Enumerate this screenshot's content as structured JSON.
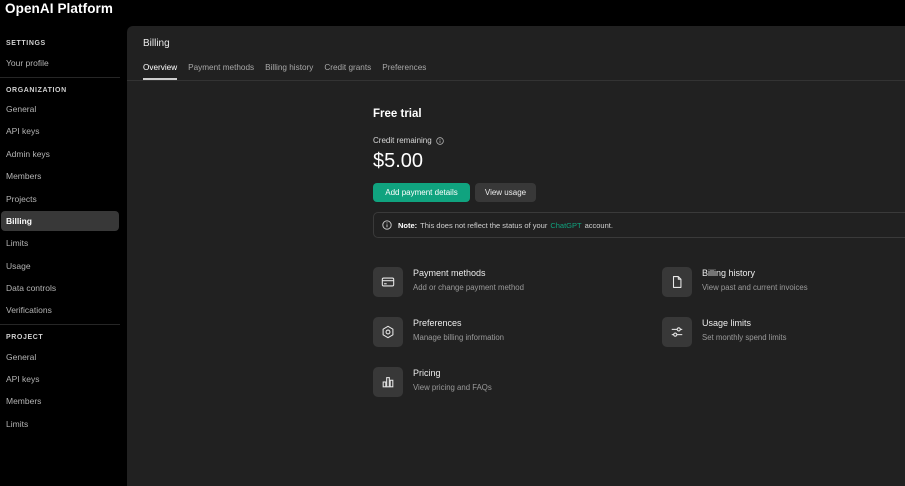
{
  "app": {
    "title": "OpenAI  Platform"
  },
  "sidebar": {
    "settings_heading": "SETTINGS",
    "settings_items": [
      {
        "label": "Your profile"
      }
    ],
    "organization_heading": "ORGANIZATION",
    "organization_items": [
      {
        "label": "General"
      },
      {
        "label": "API keys"
      },
      {
        "label": "Admin keys"
      },
      {
        "label": "Members"
      },
      {
        "label": "Projects"
      },
      {
        "label": "Billing",
        "active": true
      },
      {
        "label": "Limits"
      },
      {
        "label": "Usage"
      },
      {
        "label": "Data controls"
      },
      {
        "label": "Verifications"
      }
    ],
    "project_heading": "PROJECT",
    "project_items": [
      {
        "label": "General"
      },
      {
        "label": "API keys"
      },
      {
        "label": "Members"
      },
      {
        "label": "Limits"
      }
    ]
  },
  "main": {
    "title": "Billing",
    "tabs": [
      {
        "label": "Overview",
        "active": true
      },
      {
        "label": "Payment methods"
      },
      {
        "label": "Billing history"
      },
      {
        "label": "Credit grants"
      },
      {
        "label": "Preferences"
      }
    ],
    "trial": {
      "heading": "Free trial",
      "credit_label": "Credit remaining",
      "credit_value": "$5.00",
      "add_payment_label": "Add payment details",
      "view_usage_label": "View usage"
    },
    "note": {
      "prefix": "Note:",
      "text_before": "This does not reflect the status of your",
      "link": "ChatGPT",
      "text_after": "account."
    },
    "cards": [
      {
        "title": "Payment methods",
        "desc": "Add or change payment method",
        "icon": "credit-card-icon"
      },
      {
        "title": "Billing history",
        "desc": "View past and current invoices",
        "icon": "document-icon"
      },
      {
        "title": "Preferences",
        "desc": "Manage billing information",
        "icon": "gear-icon"
      },
      {
        "title": "Usage limits",
        "desc": "Set monthly spend limits",
        "icon": "sliders-icon"
      },
      {
        "title": "Pricing",
        "desc": "View pricing and FAQs",
        "icon": "bar-chart-icon"
      }
    ]
  },
  "colors": {
    "accent": "#10a37f",
    "background": "#000000",
    "panel": "#212121",
    "active_nav": "#383838"
  }
}
